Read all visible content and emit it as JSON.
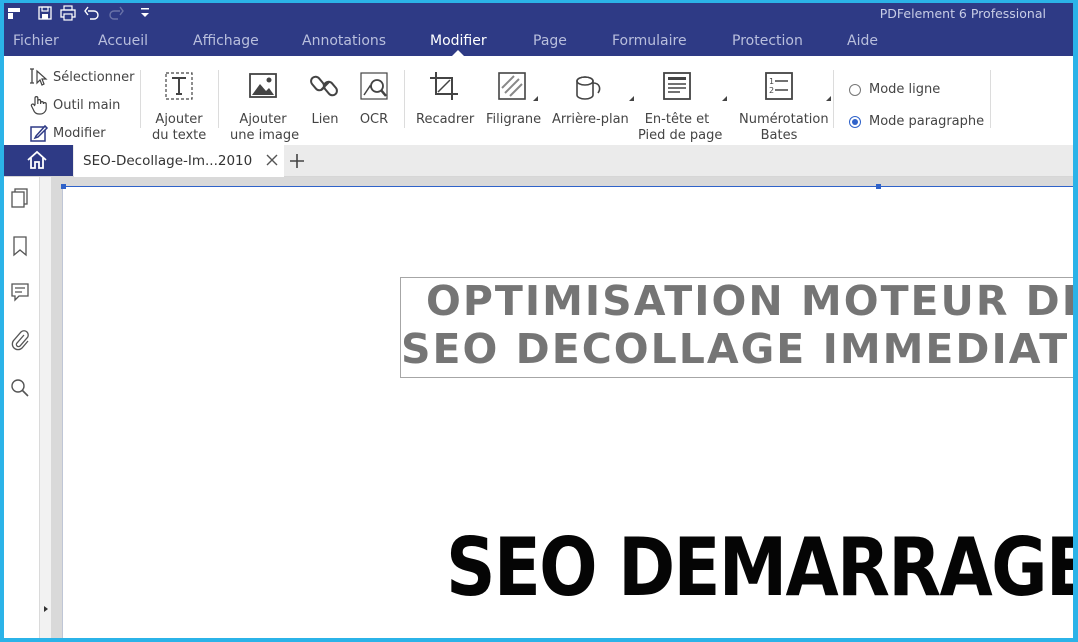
{
  "app": {
    "title": "PDFelement 6 Professional"
  },
  "quick_access": {
    "icons": [
      "app-logo-icon",
      "save-icon",
      "print-icon",
      "undo-icon",
      "redo-icon",
      "customize-icon"
    ]
  },
  "menu": {
    "items": [
      {
        "label": "Fichier"
      },
      {
        "label": "Accueil"
      },
      {
        "label": "Affichage"
      },
      {
        "label": "Annotations"
      },
      {
        "label": "Modifier"
      },
      {
        "label": "Page"
      },
      {
        "label": "Formulaire"
      },
      {
        "label": "Protection"
      },
      {
        "label": "Aide"
      }
    ],
    "active": "Modifier"
  },
  "ribbon": {
    "select_label": "Sélectionner",
    "hand_label": "Outil main",
    "edit_label": "Modifier",
    "add_text_line1": "Ajouter",
    "add_text_line2": "du texte",
    "add_image_line1": "Ajouter",
    "add_image_line2": "une image",
    "link_label": "Lien",
    "ocr_label": "OCR",
    "crop_label": "Recadrer",
    "watermark_label": "Filigrane",
    "background_label": "Arrière-plan",
    "header_line1": "En-tête et",
    "header_line2": "Pied de page",
    "bates_line1": "Numérotation",
    "bates_line2": "Bates",
    "mode_line_label": "Mode ligne",
    "mode_paragraph_label": "Mode paragraphe",
    "selected_mode": "Mode paragraphe"
  },
  "tabs": {
    "document_name": "SEO-Decollage-Im...2010"
  },
  "document": {
    "title_line1": "OPTIMISATION MOTEUR DE R",
    "title_line2": "SEO DECOLLAGE IMMEDIAT - E",
    "heading": "SEO DEMARRAGE I"
  },
  "colors": {
    "titlebar_bg": "#2e3a85",
    "menu_text": "#b9bfdd",
    "accent": "#2f62c9",
    "frame": "#2bb3e8"
  }
}
